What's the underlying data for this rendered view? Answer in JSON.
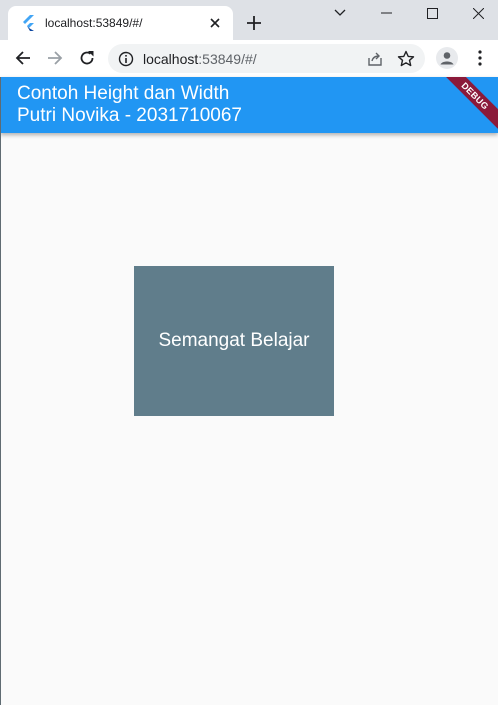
{
  "browser": {
    "tab": {
      "title": "localhost:53849/#/"
    },
    "omnibox": {
      "host": "localhost",
      "rest": ":53849/#/"
    }
  },
  "app": {
    "title_line1": "Contoh Height dan Width",
    "title_line2": "Putri Novika - 2031710067",
    "debug_banner": "DEBUG",
    "box_text": "Semangat Belajar",
    "colors": {
      "appbar": "#2196f3",
      "box": "#607d8b",
      "background": "#fafafa"
    }
  }
}
